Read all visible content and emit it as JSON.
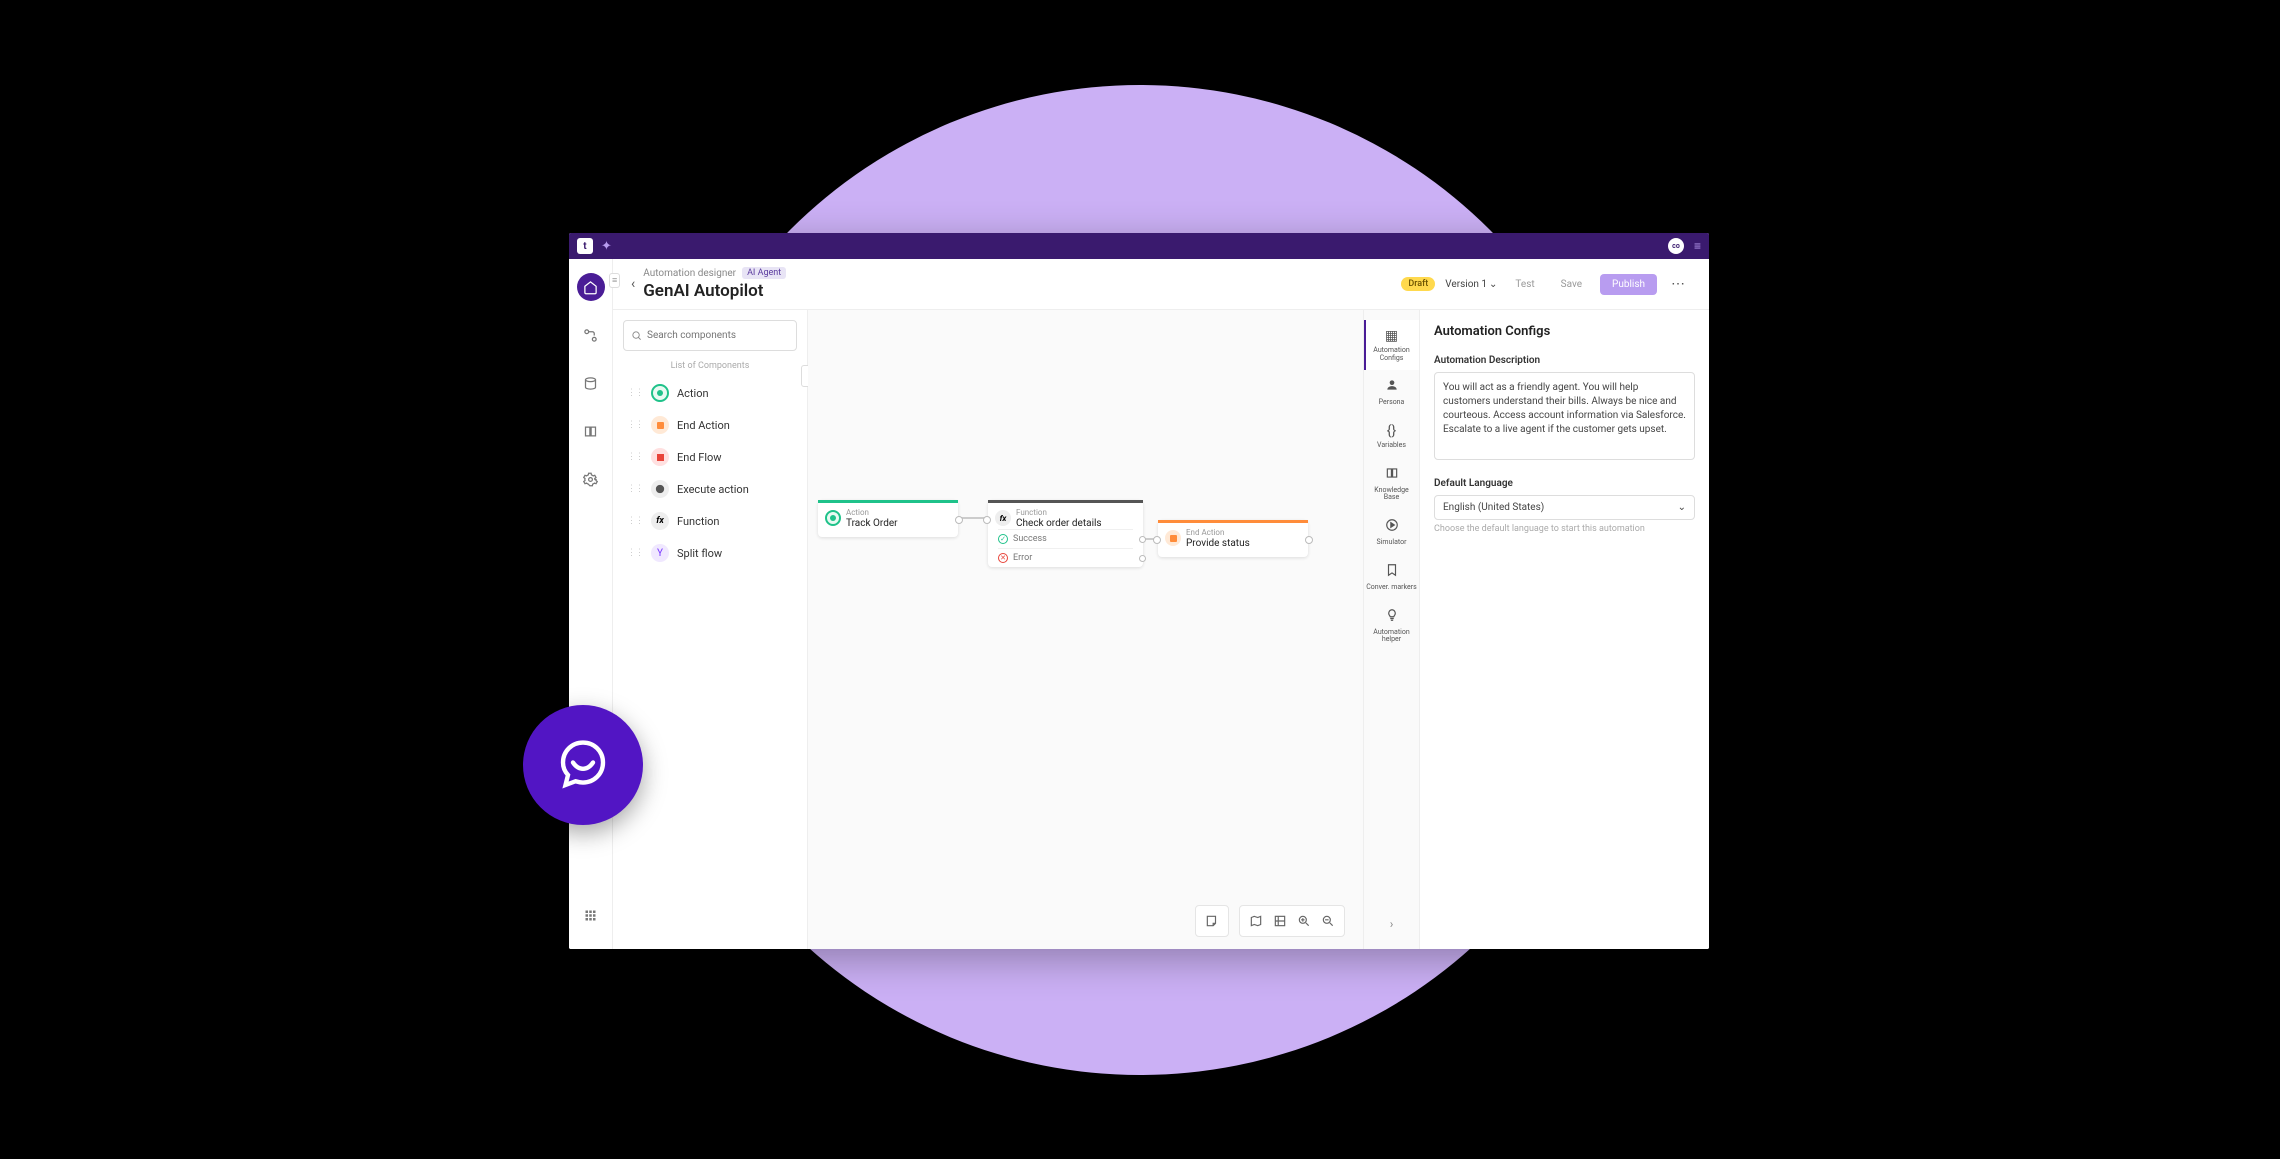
{
  "titlebar": {
    "logo_text": "t",
    "avatar": "co"
  },
  "breadcrumb": {
    "parent": "Automation designer",
    "tag": "AI Agent"
  },
  "page_title": "GenAI Autopilot",
  "header": {
    "status": "Draft",
    "version": "Version 1",
    "test": "Test",
    "save": "Save",
    "publish": "Publish"
  },
  "search": {
    "placeholder": "Search components"
  },
  "components_header": "List of Components",
  "components": [
    {
      "label": "Action"
    },
    {
      "label": "End Action"
    },
    {
      "label": "End Flow"
    },
    {
      "label": "Execute action"
    },
    {
      "label": "Function"
    },
    {
      "label": "Split flow"
    }
  ],
  "nodes": {
    "n1": {
      "type": "Action",
      "title": "Track Order"
    },
    "n2": {
      "type": "Function",
      "title": "Check order details",
      "branch1": "Success",
      "branch2": "Error"
    },
    "n3": {
      "type": "End Action",
      "title": "Provide status"
    }
  },
  "right_tabs": [
    {
      "label": "Automation Configs"
    },
    {
      "label": "Persona"
    },
    {
      "label": "Variables"
    },
    {
      "label": "Knowledge Base"
    },
    {
      "label": "Simulator"
    },
    {
      "label": "Conver. markers"
    },
    {
      "label": "Automation helper"
    }
  ],
  "config": {
    "title": "Automation Configs",
    "desc_label": "Automation Description",
    "desc_value": "You will act as a friendly agent. You will help customers understand their bills. Always be nice and courteous. Access account information via Salesforce. Escalate to a live agent if the customer gets upset.",
    "lang_label": "Default Language",
    "lang_value": "English (United States)",
    "lang_hint": "Choose the default language to start this automation"
  }
}
